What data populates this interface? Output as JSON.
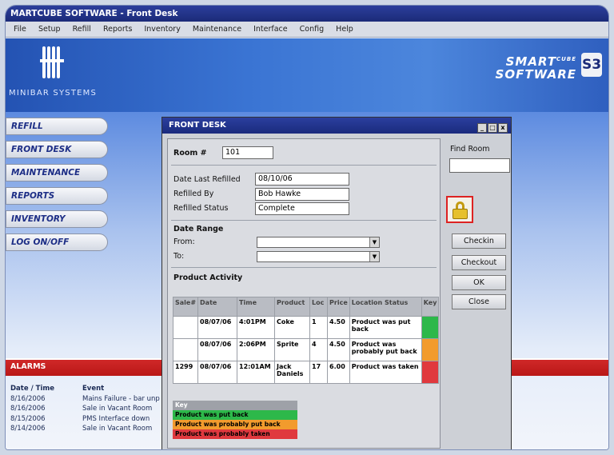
{
  "app": {
    "title": "MARTCUBE SOFTWARE - Front Desk",
    "menu": [
      "File",
      "Setup",
      "Refill",
      "Reports",
      "Inventory",
      "Maintenance",
      "Interface",
      "Config",
      "Help"
    ]
  },
  "banner": {
    "left_logo_text": "MINIBAR SYSTEMS",
    "brand_line1": "SMART",
    "brand_cube": "CUBE",
    "brand_line2": "SOFTWARE",
    "badge": "S3"
  },
  "nav": [
    "REFILL",
    "FRONT DESK",
    "MAINTENANCE",
    "REPORTS",
    "INVENTORY",
    "LOG ON/OFF"
  ],
  "alarms": {
    "title": "ALARMS",
    "headers": [
      "Date / Time",
      "Event"
    ],
    "rows": [
      [
        "8/16/2006",
        "Mains Failure - bar unp"
      ],
      [
        "8/16/2006",
        "Sale in Vacant Room"
      ],
      [
        "8/15/2006",
        "PMS Interface down"
      ],
      [
        "8/14/2006",
        "Sale in Vacant Room"
      ]
    ]
  },
  "dialog": {
    "title": "FRONT DESK",
    "win_controls": [
      "_",
      "□",
      "x"
    ],
    "room_label": "Room #",
    "room_value": "101",
    "date_last_refilled_label": "Date Last Refilled",
    "date_last_refilled_value": "08/10/06",
    "refilled_by_label": "Refilled By",
    "refilled_by_value": "Bob Hawke",
    "refilled_status_label": "Refilled Status",
    "refilled_status_value": "Complete",
    "date_range_label": "Date Range",
    "from_label": "From:",
    "to_label": "To:",
    "product_activity_label": "Product Activity",
    "find_room_label": "Find Room",
    "buttons": {
      "checkin": "Checkin",
      "checkout": "Checkout",
      "ok": "OK",
      "close": "Close"
    },
    "table": {
      "headers": [
        "Sale#",
        "Date",
        "Time",
        "Product",
        "Loc",
        "Price",
        "Location Status",
        "Key"
      ],
      "rows": [
        {
          "sale": "",
          "date": "08/07/06",
          "time": "4:01PM",
          "product": "Coke",
          "loc": "1",
          "price": "4.50",
          "status": "Product was put back",
          "key_color": "#2db84a"
        },
        {
          "sale": "",
          "date": "08/07/06",
          "time": "2:06PM",
          "product": "Sprite",
          "loc": "4",
          "price": "4.50",
          "status": "Product was probably put back",
          "key_color": "#f29b2d"
        },
        {
          "sale": "1299",
          "date": "08/07/06",
          "time": "12:01AM",
          "product": "Jack Daniels",
          "loc": "17",
          "price": "6.00",
          "status": "Product was taken",
          "key_color": "#e0393e"
        }
      ]
    },
    "key": {
      "title": "Key",
      "items": [
        {
          "label": "Product was put back",
          "color": "#2db84a"
        },
        {
          "label": "Product was probably put back",
          "color": "#f29b2d"
        },
        {
          "label": "Product was probably taken",
          "color": "#e0393e"
        }
      ]
    }
  }
}
